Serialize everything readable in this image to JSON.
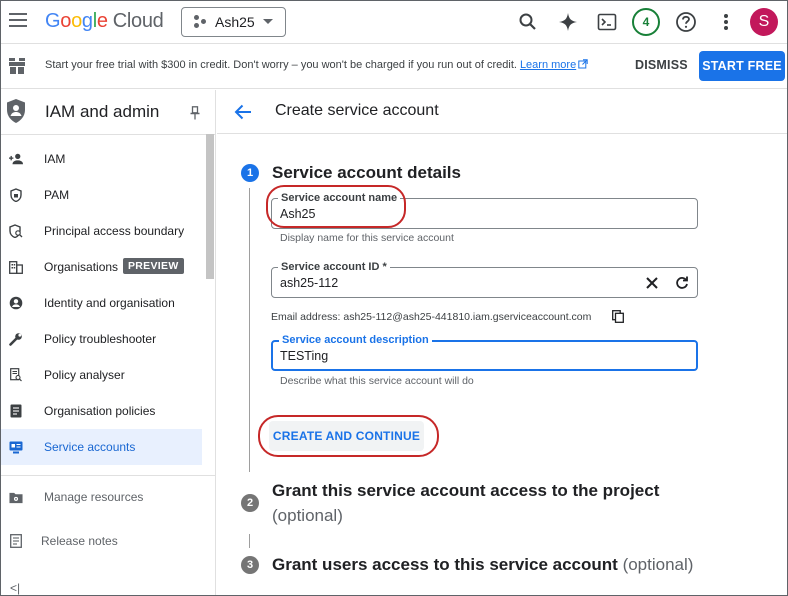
{
  "header": {
    "logo": {
      "g1": "G",
      "g2": "o",
      "g3": "o",
      "g4": "g",
      "g5": "l",
      "g6": "e",
      "cloud": "Cloud"
    },
    "project": "Ash25",
    "notification_count": "4",
    "avatar_letter": "S",
    "icons": [
      "menu-icon",
      "search-icon",
      "gemini-sparkle-icon",
      "cloud-shell-icon",
      "help-icon",
      "more-vert-icon"
    ]
  },
  "promo": {
    "message": "Start your free trial with $300 in credit. Don't worry – you won't be charged if you run out of credit.",
    "link": "Learn more",
    "dismiss": "DISMISS",
    "start": "START FREE"
  },
  "sidebar": {
    "title": "IAM and admin",
    "items": [
      {
        "label": "IAM",
        "icon": "person-add-icon"
      },
      {
        "label": "PAM",
        "icon": "shield-lock-icon"
      },
      {
        "label": "Principal access boundary",
        "icon": "shield-search-icon"
      },
      {
        "label": "Organisations",
        "icon": "building-icon",
        "badge": "PREVIEW"
      },
      {
        "label": "Identity and organisation",
        "icon": "account-circle-icon"
      },
      {
        "label": "Policy troubleshooter",
        "icon": "wrench-icon"
      },
      {
        "label": "Policy analyser",
        "icon": "document-search-icon"
      },
      {
        "label": "Organisation policies",
        "icon": "list-doc-icon"
      },
      {
        "label": "Service accounts",
        "icon": "service-account-icon",
        "active": true
      }
    ],
    "footer_items": [
      {
        "label": "Manage resources",
        "icon": "gear-folder-icon"
      },
      {
        "label": "Release notes",
        "icon": "notes-icon"
      }
    ],
    "collapse": "<|"
  },
  "main": {
    "title": "Create service account",
    "steps": [
      {
        "num": "1",
        "title": "Service account details"
      },
      {
        "num": "2",
        "title": "Grant this service account access to the project",
        "optional": "(optional)"
      },
      {
        "num": "3",
        "title": "Grant users access to this service account",
        "optional": "(optional)"
      }
    ],
    "form": {
      "name_label": "Service account name",
      "name_value": "Ash25",
      "name_hint": "Display name for this service account",
      "id_label": "Service account ID *",
      "id_value": "ash25-112",
      "email_text": "Email address: ash25-112@ash25-441810.iam.gserviceaccount.com",
      "desc_label": "Service account description",
      "desc_value": "TESTing",
      "desc_hint": "Describe what this service account will do"
    },
    "create_button": "CREATE AND CONTINUE"
  },
  "colors": {
    "accent": "#1a73e8",
    "highlight": "#c62828",
    "active_bg": "#e8f0fe"
  }
}
